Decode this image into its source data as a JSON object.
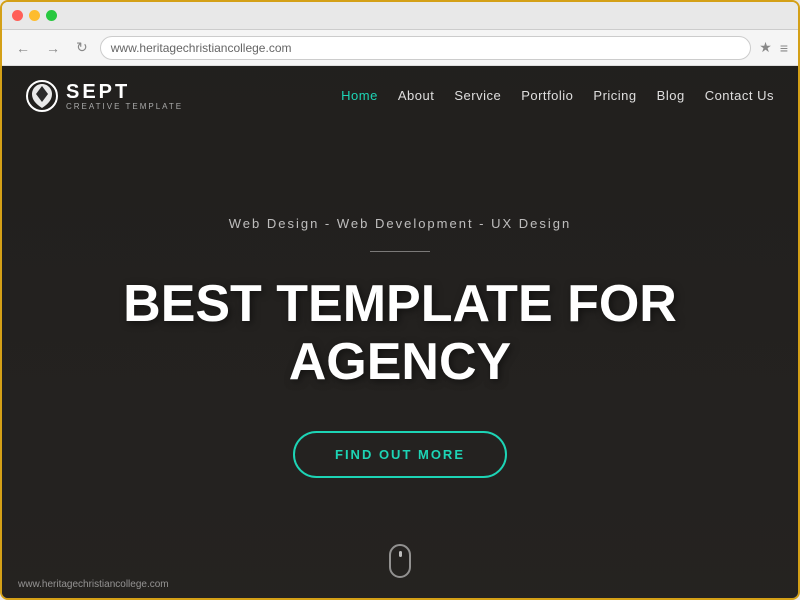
{
  "browser": {
    "address": "www.heritagechristiancollege.com",
    "back_label": "←",
    "forward_label": "→",
    "refresh_label": "↻",
    "star_label": "★",
    "menu_label": "≡"
  },
  "logo": {
    "main": "SEPT",
    "sub": "CREATIVE TEMPLATE"
  },
  "nav": {
    "items": [
      {
        "label": "Home",
        "active": true
      },
      {
        "label": "About",
        "active": false
      },
      {
        "label": "Service",
        "active": false
      },
      {
        "label": "Portfolio",
        "active": false
      },
      {
        "label": "Pricing",
        "active": false
      },
      {
        "label": "Blog",
        "active": false
      },
      {
        "label": "Contact Us",
        "active": false
      }
    ]
  },
  "hero": {
    "subtitle": "Web Design - Web Development - UX Design",
    "title_line1": "BEST TEMPLATE FOR",
    "title_line2": "AGENCY",
    "cta_label": "FIND OUT MORE"
  },
  "footer": {
    "url": "www.heritagechristiancollege.com"
  }
}
